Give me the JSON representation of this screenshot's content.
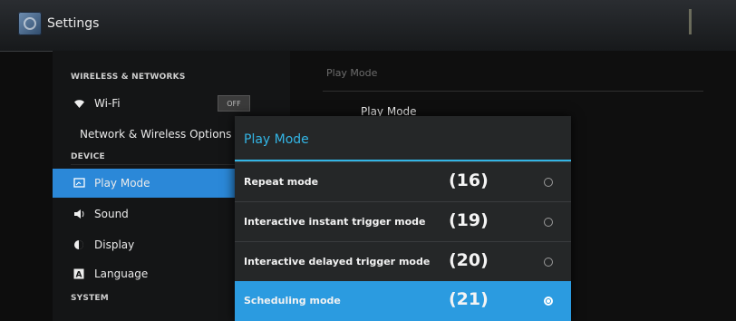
{
  "window": {
    "title": "Settings"
  },
  "sidebar": {
    "sections": {
      "wireless": "WIRELESS & NETWORKS",
      "device": "DEVICE",
      "system": "SYSTEM"
    },
    "items": [
      {
        "label": "Wi-Fi",
        "icon": "wifi-icon",
        "toggle": "OFF"
      },
      {
        "label": "Network & Wireless Options"
      },
      {
        "label": "Play Mode",
        "icon": "screen-icon",
        "selected": true
      },
      {
        "label": "Sound",
        "icon": "speaker-icon"
      },
      {
        "label": "Display",
        "icon": "brightness-icon"
      },
      {
        "label": "Language",
        "icon": "language-icon"
      }
    ]
  },
  "detail": {
    "header": "Play Mode",
    "item": "Play Mode"
  },
  "dialog": {
    "title": "Play Mode",
    "options": [
      {
        "label": "Repeat mode",
        "number": "(16)",
        "selected": false
      },
      {
        "label": "Interactive instant trigger mode",
        "number": "(19)",
        "selected": false
      },
      {
        "label": "Interactive delayed trigger mode",
        "number": "(20)",
        "selected": false
      },
      {
        "label": "Scheduling mode",
        "number": "(21)",
        "selected": true
      }
    ]
  },
  "colors": {
    "accent": "#33b5e5",
    "selected_bg": "#2b88d8"
  }
}
